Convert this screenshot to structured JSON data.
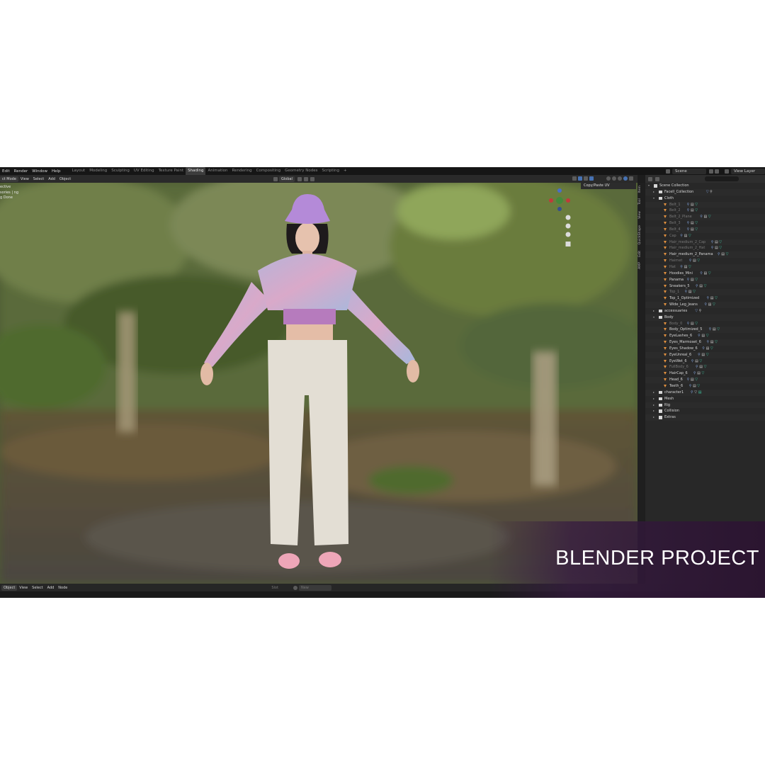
{
  "menubar": {
    "items": [
      "Edit",
      "Render",
      "Window",
      "Help"
    ],
    "workspaces": [
      "Layout",
      "Modeling",
      "Sculpting",
      "UV Editing",
      "Texture Paint",
      "Shading",
      "Animation",
      "Rendering",
      "Compositing",
      "Geometry Nodes",
      "Scripting"
    ],
    "active_workspace": "Shading",
    "add_tab": "+",
    "scene": "Scene",
    "view_layer": "View Layer"
  },
  "viewport_header": {
    "mode": "ct Mode",
    "menus": [
      "View",
      "Select",
      "Add",
      "Object"
    ],
    "orientation": "Global"
  },
  "viewport_info": [
    "ective",
    "sories | ng",
    "g Done"
  ],
  "copy_paste_uv": "Copy/Paste UV",
  "sidebar_tabs": [
    "Item",
    "Tool",
    "View",
    "QuickShape",
    "Edit",
    "AMP"
  ],
  "outliner": {
    "rows": [
      {
        "label": "Scene Collection",
        "type": "scene",
        "indent": 0,
        "dim": false,
        "mods": ""
      },
      {
        "label": "Facell_Collection",
        "type": "coll",
        "indent": 1,
        "dim": false,
        "mods": "▽ ⚲"
      },
      {
        "label": "Cloth",
        "type": "coll",
        "indent": 1,
        "dim": false,
        "mods": ""
      },
      {
        "label": "Belt_1",
        "type": "obj",
        "indent": 2,
        "dim": true,
        "mods": "⚲ ▤ ▽"
      },
      {
        "label": "Belt_2",
        "type": "obj",
        "indent": 2,
        "dim": true,
        "mods": "⚲ ▤ ▽"
      },
      {
        "label": "Belt_2_Plane",
        "type": "obj",
        "indent": 2,
        "dim": true,
        "mods": "⚲ ▤ ▽"
      },
      {
        "label": "Belt_3",
        "type": "obj",
        "indent": 2,
        "dim": true,
        "mods": "⚲ ▤ ▽"
      },
      {
        "label": "Belt_4",
        "type": "obj",
        "indent": 2,
        "dim": true,
        "mods": "⚲ ▤ ▽"
      },
      {
        "label": "Cap",
        "type": "obj",
        "indent": 2,
        "dim": true,
        "mods": "⚲ ▤ ▽"
      },
      {
        "label": "Hair_medium_2_Cap",
        "type": "obj",
        "indent": 2,
        "dim": true,
        "mods": "⚲ ▤ ▽"
      },
      {
        "label": "Hair_medium_2_Hat",
        "type": "obj",
        "indent": 2,
        "dim": true,
        "mods": "⚲ ▤ ▽"
      },
      {
        "label": "Hair_medium_2_Panama",
        "type": "obj",
        "indent": 2,
        "dim": false,
        "mods": "⚲ ▤ ▽"
      },
      {
        "label": "Hairnet",
        "type": "obj",
        "indent": 2,
        "dim": true,
        "mods": "⚲ ▤ ▽"
      },
      {
        "label": "Hat",
        "type": "obj",
        "indent": 2,
        "dim": true,
        "mods": "⚲ ▤ ▽"
      },
      {
        "label": "Hoodies_Mini",
        "type": "obj",
        "indent": 2,
        "dim": false,
        "mods": "⚲ ▤ ▽"
      },
      {
        "label": "Panama",
        "type": "obj",
        "indent": 2,
        "dim": false,
        "mods": "⚲ ▤ ▽"
      },
      {
        "label": "Sneakers_5",
        "type": "obj",
        "indent": 2,
        "dim": false,
        "mods": "⚲ ▤ ▽"
      },
      {
        "label": "Top_1",
        "type": "obj",
        "indent": 2,
        "dim": true,
        "mods": "⚲ ▤ ▽"
      },
      {
        "label": "Top_1_Optimized",
        "type": "obj",
        "indent": 2,
        "dim": false,
        "mods": "⚲ ▤ ▽"
      },
      {
        "label": "Wide_Leg_Jeans",
        "type": "obj",
        "indent": 2,
        "dim": false,
        "mods": "⚲ ▤ ▽"
      },
      {
        "label": "accessuaries",
        "type": "coll",
        "indent": 1,
        "dim": false,
        "mods": "▽ ⚲"
      },
      {
        "label": "Body",
        "type": "coll",
        "indent": 1,
        "dim": false,
        "mods": ""
      },
      {
        "label": "Body_0",
        "type": "obj",
        "indent": 2,
        "dim": true,
        "mods": "⚲ ▤ ▽"
      },
      {
        "label": "Body_Optimized_5",
        "type": "obj",
        "indent": 2,
        "dim": false,
        "mods": "⚲ ▤ ▽"
      },
      {
        "label": "EyeLashes_6",
        "type": "obj",
        "indent": 2,
        "dim": false,
        "mods": "⚲ ▤ ▽"
      },
      {
        "label": "Eyes_Marmoset_6",
        "type": "obj",
        "indent": 2,
        "dim": false,
        "mods": "⚲ ▤ ▽"
      },
      {
        "label": "Eyes_Shadow_6",
        "type": "obj",
        "indent": 2,
        "dim": false,
        "mods": "⚲ ▤ ▽"
      },
      {
        "label": "EyeUnreal_6",
        "type": "obj",
        "indent": 2,
        "dim": false,
        "mods": "⚲ ▤ ▽"
      },
      {
        "label": "EyeWet_6",
        "type": "obj",
        "indent": 2,
        "dim": false,
        "mods": "⚲ ▤ ▽"
      },
      {
        "label": "FullBody_6",
        "type": "obj",
        "indent": 2,
        "dim": true,
        "mods": "⚲ ▤ ▽"
      },
      {
        "label": "HairCap_6",
        "type": "obj",
        "indent": 2,
        "dim": false,
        "mods": "⚲ ▤ ▽"
      },
      {
        "label": "Head_6",
        "type": "obj",
        "indent": 2,
        "dim": false,
        "mods": "⚲ ▤ ▽"
      },
      {
        "label": "Teeth_6",
        "type": "obj",
        "indent": 2,
        "dim": false,
        "mods": "⚲ ▤ ▽"
      },
      {
        "label": "character1",
        "type": "coll",
        "indent": 1,
        "dim": false,
        "mods": "⚲ ▽ ▤"
      },
      {
        "label": "Mesh",
        "type": "coll",
        "indent": 1,
        "dim": false,
        "mods": ""
      },
      {
        "label": "Rig",
        "type": "coll",
        "indent": 1,
        "dim": false,
        "mods": ""
      },
      {
        "label": "Collision",
        "type": "coll",
        "indent": 1,
        "dim": false,
        "mods": ""
      },
      {
        "label": "Extras",
        "type": "coll",
        "indent": 1,
        "dim": false,
        "mods": ""
      }
    ]
  },
  "shader_header": {
    "mode": "Object",
    "menus": [
      "View",
      "Select",
      "Add",
      "Node"
    ],
    "slot": "Slot",
    "new": "New"
  },
  "banner": {
    "title": "BLENDER PROJECT"
  },
  "colors": {
    "accent": "#4772b3",
    "banner": "#2b1530"
  }
}
